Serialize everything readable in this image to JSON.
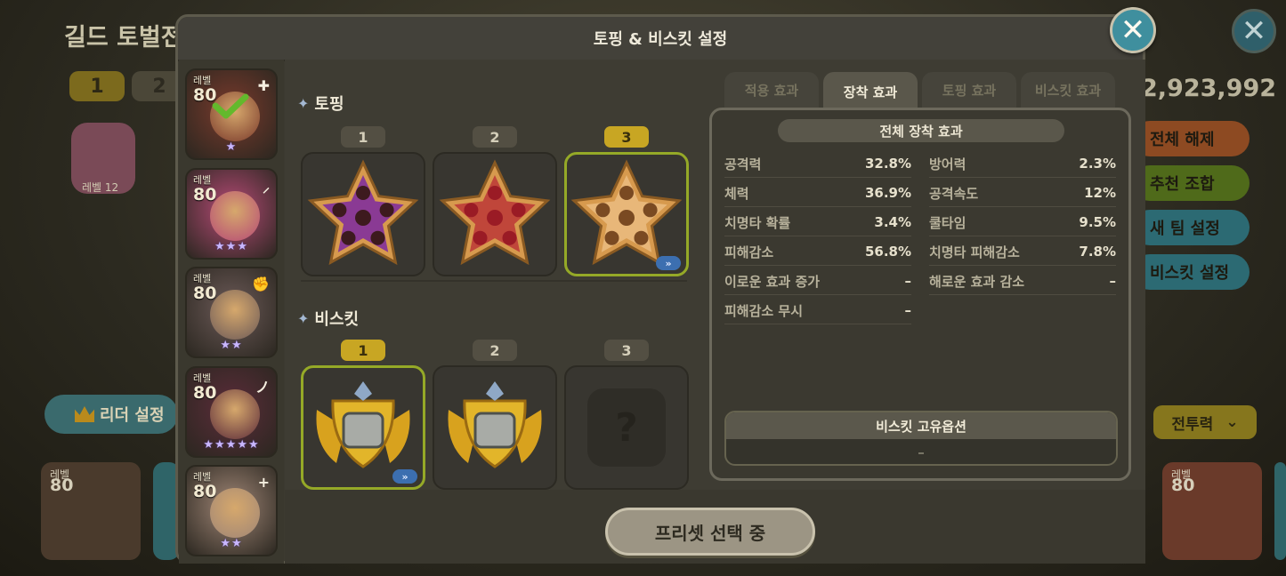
{
  "background": {
    "title": "길드 토벌전",
    "page_tabs": [
      "1",
      "2"
    ],
    "level_badge": "레벨 12",
    "leader_button": "리더 설정",
    "gold_amount": "2,923,992",
    "right_buttons": [
      {
        "label": "전체 해제",
        "color": "#8d4a22"
      },
      {
        "label": "추천 조합",
        "color": "#4f6a1a"
      },
      {
        "label": "새 팀 설정",
        "color": "#2c6a73"
      },
      {
        "label": "비스킷 설정",
        "color": "#2c6a73"
      }
    ],
    "sort_dropdown": "전투력",
    "bottom_cards": [
      {
        "level_label": "레벨",
        "level": "80"
      },
      {
        "level_label": "레벨",
        "level": "80"
      },
      {
        "level_label": "레벨",
        "level": "80"
      }
    ]
  },
  "dialog": {
    "title": "토핑 & 비스킷 설정",
    "close_icon": "close-icon",
    "cookies": [
      {
        "level_label": "레벨",
        "level": "80",
        "stars": "★",
        "selected": true,
        "tag": "✚",
        "color": "#7a3a2c"
      },
      {
        "level_label": "레벨",
        "level": "80",
        "stars": "★★★",
        "selected": false,
        "tag": "⸝",
        "color": "#b64a76"
      },
      {
        "level_label": "레벨",
        "level": "80",
        "stars": "★★",
        "selected": false,
        "tag": "✊",
        "color": "#6c5a58"
      },
      {
        "level_label": "레벨",
        "level": "80",
        "stars": "★★★★★",
        "selected": false,
        "tag": "ノ",
        "color": "#5c2c3a"
      },
      {
        "level_label": "레벨",
        "level": "80",
        "stars": "★★",
        "selected": false,
        "tag": "+",
        "color": "#a08676"
      }
    ],
    "topping": {
      "label": "토핑",
      "slots": [
        {
          "number": "1",
          "active": false,
          "selected": false,
          "fill": "#8a3a94",
          "gem": "#3d1a1e"
        },
        {
          "number": "2",
          "active": false,
          "selected": false,
          "fill": "#c0463a",
          "gem": "#9a1b25"
        },
        {
          "number": "3",
          "active": true,
          "selected": true,
          "fill": "#e8b779",
          "gem": "#7a4a22"
        }
      ]
    },
    "biscuit": {
      "label": "비스킷",
      "slots": [
        {
          "number": "1",
          "active": true,
          "selected": true,
          "empty": false
        },
        {
          "number": "2",
          "active": false,
          "selected": false,
          "empty": false
        },
        {
          "number": "3",
          "active": false,
          "selected": false,
          "empty": true,
          "empty_mark": "?"
        }
      ]
    },
    "tabs": [
      {
        "label": "적용 효과",
        "active": false
      },
      {
        "label": "장착 효과",
        "active": true
      },
      {
        "label": "토핑 효과",
        "active": false
      },
      {
        "label": "비스킷 효과",
        "active": false
      }
    ],
    "effects": {
      "header": "전체 장착 효과",
      "left": [
        {
          "name": "공격력",
          "value": "32.8%"
        },
        {
          "name": "체력",
          "value": "36.9%"
        },
        {
          "name": "치명타 확률",
          "value": "3.4%"
        },
        {
          "name": "피해감소",
          "value": "56.8%"
        },
        {
          "name": "이로운 효과 증가",
          "value": "–"
        },
        {
          "name": "피해감소 무시",
          "value": "–"
        }
      ],
      "right": [
        {
          "name": "방어력",
          "value": "2.3%"
        },
        {
          "name": "공격속도",
          "value": "12%"
        },
        {
          "name": "쿨타임",
          "value": "9.5%"
        },
        {
          "name": "치명타 피해감소",
          "value": "7.8%"
        },
        {
          "name": "해로운 효과 감소",
          "value": "–"
        }
      ],
      "unique_title": "비스킷 고유옵션",
      "unique_value": "–"
    },
    "preset_button": "프리셋 선택 중"
  }
}
